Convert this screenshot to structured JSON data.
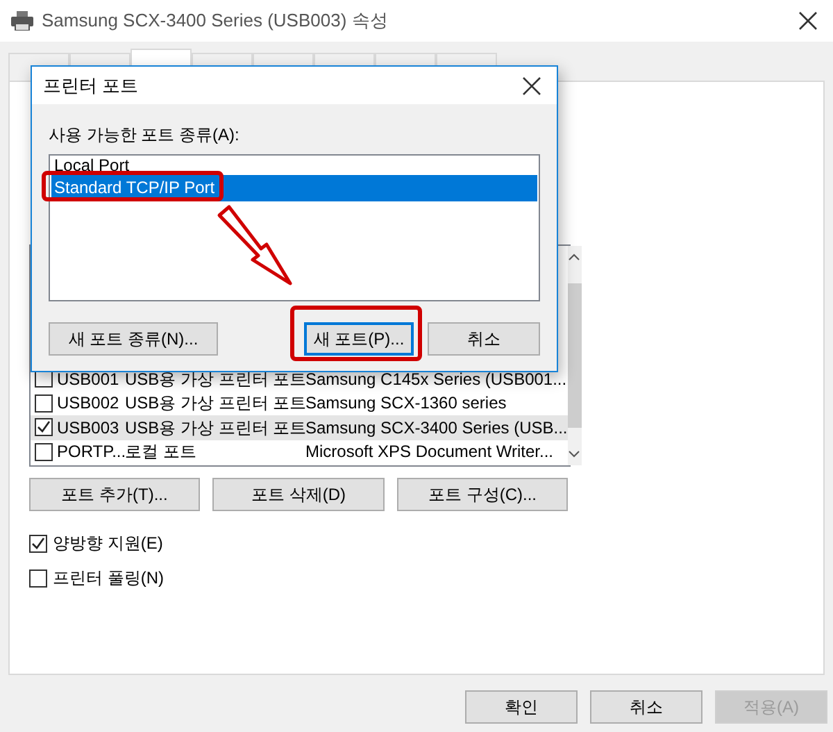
{
  "window": {
    "title": "Samsung SCX-3400 Series (USB003) 속성"
  },
  "tabs": [
    {
      "selected": false
    },
    {
      "selected": false
    },
    {
      "selected": true
    },
    {
      "selected": false
    },
    {
      "selected": false
    },
    {
      "selected": false
    },
    {
      "selected": false
    },
    {
      "selected": false
    }
  ],
  "port_list": {
    "rows": [
      {
        "checked": false,
        "selected": false,
        "port": "USB001",
        "description": "USB용 가상 프린터 포트",
        "printer": "Samsung C145x Series (USB001..."
      },
      {
        "checked": false,
        "selected": false,
        "port": "USB002",
        "description": "USB용 가상 프린터 포트",
        "printer": "Samsung SCX-1360 series"
      },
      {
        "checked": true,
        "selected": true,
        "port": "USB003",
        "description": "USB용 가상 프린터 포트",
        "printer": "Samsung SCX-3400 Series (USB..."
      },
      {
        "checked": false,
        "selected": false,
        "port": "PORTP...",
        "description": "로컬 포트",
        "printer": "Microsoft XPS Document Writer..."
      }
    ]
  },
  "port_buttons": [
    "포트 추가(T)...",
    "포트 삭제(D)",
    "포트 구성(C)..."
  ],
  "options": [
    {
      "label": "양방향 지원(E)",
      "checked": true
    },
    {
      "label": "프린터 풀링(N)",
      "checked": false
    }
  ],
  "footer_buttons": [
    {
      "label": "확인",
      "disabled": false
    },
    {
      "label": "취소",
      "disabled": false
    },
    {
      "label": "적용(A)",
      "disabled": true
    }
  ],
  "dialog": {
    "title": "프린터 포트",
    "list_label": "사용 가능한 포트 종류(A):",
    "port_types": [
      {
        "label": "Local Port",
        "selected": false
      },
      {
        "label": "Standard TCP/IP Port",
        "selected": true
      }
    ],
    "buttons": [
      {
        "label": "새 포트 종류(N)...",
        "focused": false
      },
      {
        "label": "새 포트(P)...",
        "focused": true
      },
      {
        "label": "취소",
        "focused": false
      }
    ]
  }
}
